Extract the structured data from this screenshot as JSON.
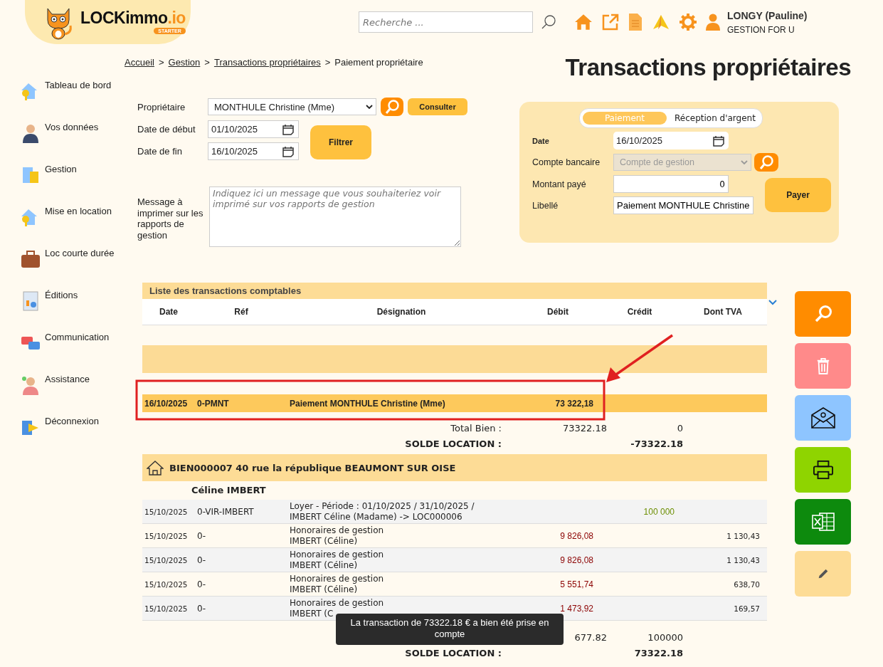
{
  "header": {
    "logo": {
      "name": "LOCKimmo",
      "suffix": ".io",
      "badge": "STARTER"
    },
    "search": {
      "placeholder": "Recherche ..."
    },
    "user": {
      "name": "LONGY (Pauline)",
      "company": "GESTION FOR U"
    }
  },
  "breadcrumb": [
    {
      "label": "Accueil",
      "link": true
    },
    {
      "prefix": ">",
      "label": "Gestion",
      "link": true
    },
    {
      "prefix": ">",
      "label": "Transactions propriétaires",
      "link": true
    },
    {
      "prefix": ">",
      "label": "Paiement propriétaire",
      "link": false
    }
  ],
  "page_title": "Transactions propriétaires",
  "sidebar": {
    "items": [
      {
        "label": "Tableau de bord",
        "kind": "house"
      },
      {
        "label": "Vos données",
        "kind": "person"
      },
      {
        "label": "Gestion",
        "kind": "calc"
      },
      {
        "label": "Mise en location",
        "kind": "house"
      },
      {
        "label": "Loc courte durée",
        "kind": "suitcase"
      },
      {
        "label": "Éditions",
        "kind": "doc"
      },
      {
        "label": "Communication",
        "kind": "chat"
      },
      {
        "label": "Assistance",
        "kind": "agent"
      },
      {
        "label": "Déconnexion",
        "kind": "exit"
      }
    ]
  },
  "filter": {
    "owner_label": "Propriétaire",
    "owner": "MONTHULE Christine (Mme)",
    "consult_button": "Consulter",
    "start_label": "Date de début",
    "start": "01/10/2025",
    "end_label": "Date de fin",
    "end": "16/10/2025",
    "filter_button": "Filtrer",
    "message_label": "Message à imprimer sur les rapports de gestion",
    "message_placeholder": "Indiquez ici un message que vous souhaiteriez voir imprimé sur vos rapports de gestion"
  },
  "payment": {
    "tabs": [
      {
        "label": "Paiement",
        "selected": true
      },
      {
        "label": "Réception d'argent",
        "selected": false
      }
    ],
    "date_label": "Date",
    "date": "16/10/2025",
    "account_label": "Compte bancaire",
    "account": "Compte de gestion",
    "account_disabled": true,
    "amount_label": "Montant payé",
    "amount": "0",
    "libelle_label": "Libellé",
    "libelle": "Paiement MONTHULE Christine",
    "pay_button": "Payer"
  },
  "transactions": {
    "title": "Liste des transactions comptables",
    "columns": [
      "Date",
      "Réf",
      "Désignation",
      "Débit",
      "Crédit",
      "Dont TVA"
    ],
    "highlight_row": {
      "date": "16/10/2025",
      "ref": "0-PMNT",
      "designation": "Paiement MONTHULE Christine (Mme)",
      "debit": "73 322,18"
    },
    "totals_1": {
      "label": "Total Bien :",
      "debit": "73322.18",
      "credit": "0",
      "balance_label": "SOLDE LOCATION :",
      "balance": "-73322.18"
    },
    "property": {
      "title": "BIEN000007 40 rue la république BEAUMONT SUR OISE",
      "tenant": "Céline IMBERT",
      "rows": [
        {
          "date": "15/10/2025",
          "ref": "0-VIR-IMBERT",
          "designation": [
            "Loyer - Période : 01/10/2025 / 31/10/2025 /",
            "IMBERT Céline (Madame) -> LOC000006"
          ],
          "debit": "",
          "credit": "100 000",
          "vat": ""
        },
        {
          "date": "15/10/2025",
          "ref": "0-",
          "designation": [
            "Honoraires de gestion",
            "IMBERT (Céline)"
          ],
          "debit": "9 826,08",
          "credit": "",
          "vat": "1 130,43"
        },
        {
          "date": "15/10/2025",
          "ref": "0-",
          "designation": [
            "Honoraires de gestion",
            "IMBERT (Céline)"
          ],
          "debit": "9 826,08",
          "credit": "",
          "vat": "1 130,43"
        },
        {
          "date": "15/10/2025",
          "ref": "0-",
          "designation": [
            "Honoraires de gestion",
            "IMBERT (Céline)"
          ],
          "debit": "5 551,74",
          "credit": "",
          "vat": "638,70"
        },
        {
          "date": "15/10/2025",
          "ref": "0-",
          "designation": [
            "Honoraires de gestion",
            "IMBERT (C"
          ],
          "debit": "1 473,92",
          "credit": "",
          "vat": "169,57"
        }
      ],
      "totals": {
        "debit": "677.82",
        "credit": "100000",
        "balance_label": "SOLDE LOCATION :",
        "balance": "73322.18"
      }
    }
  },
  "actions": [
    {
      "kind": "search"
    },
    {
      "kind": "delete"
    },
    {
      "kind": "mail"
    },
    {
      "kind": "print"
    },
    {
      "kind": "excel"
    },
    {
      "kind": "edit"
    }
  ],
  "toast": "La transaction de 73322.18 € a bien été prise en compte"
}
